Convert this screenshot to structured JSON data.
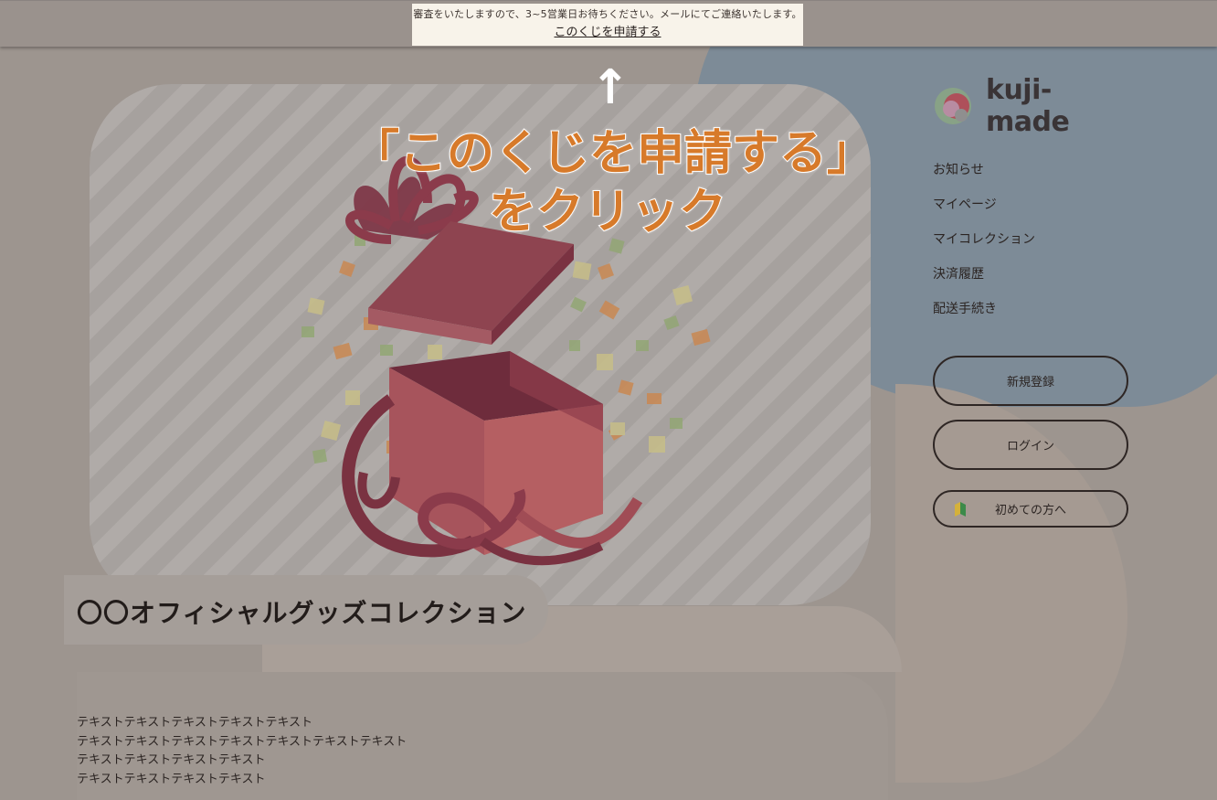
{
  "notice": {
    "message": "審査をいたしますので、3~5営業日お待ちください。メールにてご連絡いたします。",
    "link_label": "このくじを申請する"
  },
  "overlay": {
    "arrow": "↑",
    "line1": "「このくじを申請する」",
    "line2": "をクリック"
  },
  "brand": {
    "name": "kuji-made"
  },
  "nav": {
    "items": [
      "お知らせ",
      "マイページ",
      "マイコレクション",
      "決済履歴",
      "配送手続き"
    ]
  },
  "buttons": {
    "register": "新規登録",
    "login": "ログイン",
    "beginner": "初めての方へ"
  },
  "main": {
    "title": "〇〇オフィシャルグッズコレクション",
    "body_lines": [
      "テキストテキストテキストテキストテキスト",
      "テキストテキストテキストテキストテキストテキストテキスト",
      "テキストテキストテキストテキスト",
      "テキストテキストテキストテキスト"
    ]
  },
  "colors": {
    "overlay_text": "#d77a2a",
    "backdrop": "#9d958f",
    "blue_blob": "#7d8b97"
  },
  "icons": {
    "up_arrow": "up-arrow-icon",
    "beginner": "beginner-mark-icon",
    "logo": "kuji-made-logo-icon",
    "hero": "gift-box-illustration"
  }
}
